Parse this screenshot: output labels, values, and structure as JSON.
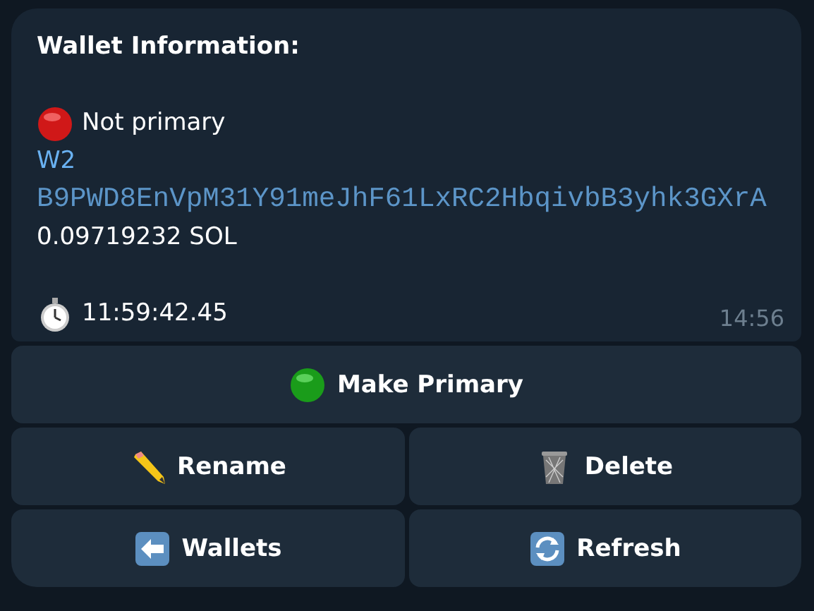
{
  "message": {
    "title": "Wallet Information:",
    "status": {
      "kind": "red-circle",
      "text": "Not primary"
    },
    "wallet_name": "W2",
    "address": "B9PWD8EnVpM31Y91meJhF61LxRC2HbqivbB3yhk3GXrA",
    "balance": "0.09719232 SOL",
    "timer": {
      "kind": "stopwatch",
      "text": "11:59:42.45"
    },
    "time": "14:56"
  },
  "keyboard": [
    [
      {
        "kind": "green-circle",
        "label": "Make Primary"
      }
    ],
    [
      {
        "kind": "pencil",
        "label": "Rename"
      },
      {
        "kind": "trash",
        "label": "Delete"
      }
    ],
    [
      {
        "kind": "back-arrow",
        "label": "Wallets"
      },
      {
        "kind": "refresh",
        "label": "Refresh"
      }
    ]
  ]
}
